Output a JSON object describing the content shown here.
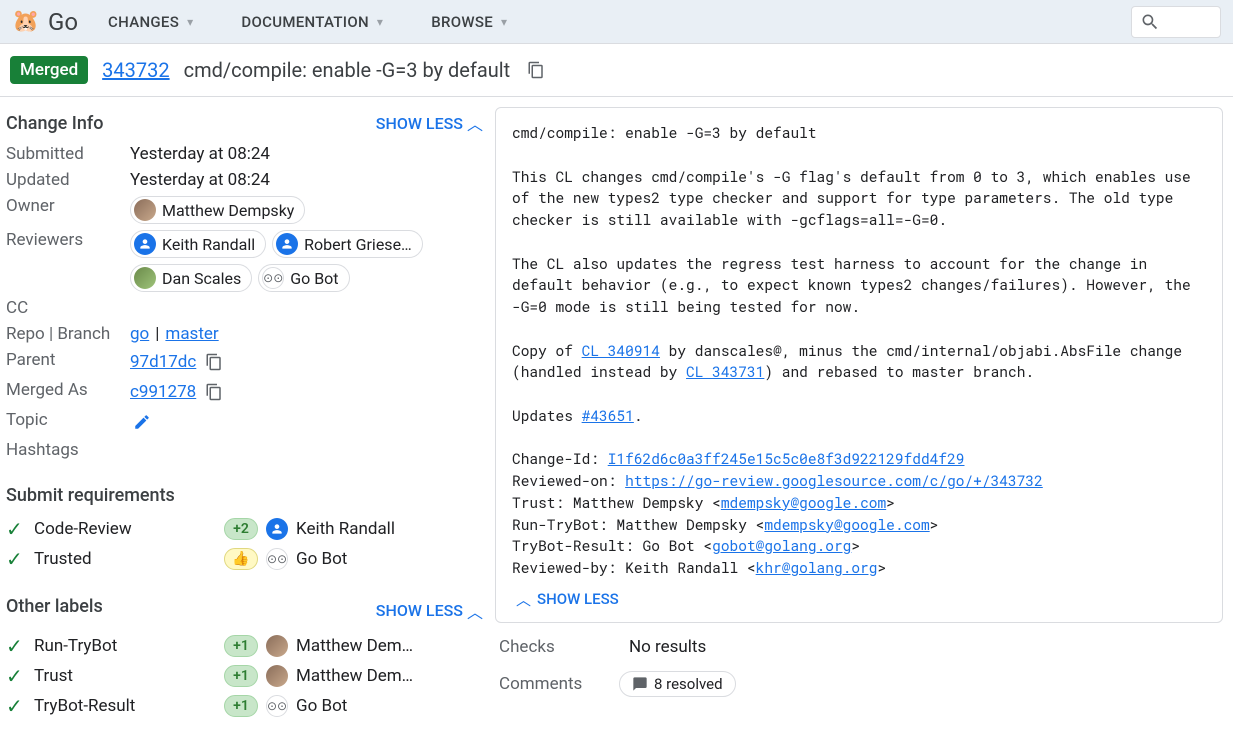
{
  "nav": {
    "brand": "Go",
    "items": [
      "CHANGES",
      "DOCUMENTATION",
      "BROWSE"
    ]
  },
  "header": {
    "status": "Merged",
    "cl_number": "343732",
    "subject": "cmd/compile: enable -G=3 by default"
  },
  "info": {
    "title": "Change Info",
    "showless": "SHOW LESS",
    "submitted_label": "Submitted",
    "submitted_value": "Yesterday at 08:24",
    "updated_label": "Updated",
    "updated_value": "Yesterday at 08:24",
    "owner_label": "Owner",
    "owner": "Matthew Dempsky",
    "reviewers_label": "Reviewers",
    "reviewers": [
      "Keith Randall",
      "Robert Griese…",
      "Dan Scales",
      "Go Bot"
    ],
    "cc_label": "CC",
    "repo_label": "Repo | Branch",
    "repo": "go",
    "branch": "master",
    "parent_label": "Parent",
    "parent": "97d17dc",
    "merged_label": "Merged As",
    "merged_as": "c991278",
    "topic_label": "Topic",
    "hashtags_label": "Hashtags"
  },
  "submit_req": {
    "title": "Submit requirements",
    "items": [
      {
        "name": "Code-Review",
        "vote": "+2",
        "vote_type": "green",
        "user": "Keith Randall",
        "avatar": "generic"
      },
      {
        "name": "Trusted",
        "vote": "👍",
        "vote_type": "thumb",
        "user": "Go Bot",
        "avatar": "bot"
      }
    ]
  },
  "other_labels": {
    "title": "Other labels",
    "showless": "SHOW LESS",
    "items": [
      {
        "name": "Run-TryBot",
        "vote": "+1",
        "user": "Matthew Dem…",
        "avatar": "photo1"
      },
      {
        "name": "Trust",
        "vote": "+1",
        "user": "Matthew Dem…",
        "avatar": "photo1"
      },
      {
        "name": "TryBot-Result",
        "vote": "+1",
        "user": "Go Bot",
        "avatar": "bot"
      }
    ]
  },
  "message": {
    "line1": "cmd/compile: enable -G=3 by default",
    "para1": "This CL changes cmd/compile's -G flag's default from 0 to 3, which enables use of the new types2 type checker and support for type parameters. The old type checker is still available with -gcflags=all=-G=0.",
    "para2": "The CL also updates the regress test harness to account for the change in default behavior (e.g., to expect known types2 changes/failures). However, the -G=0 mode is still being tested for now.",
    "copy_pre": "Copy of ",
    "copy_link": "CL 340914",
    "copy_post": " by danscales@, minus the cmd/internal/objabi.AbsFile change (handled instead by ",
    "copy_link2": "CL 343731",
    "copy_post2": ") and rebased to master branch.",
    "updates_pre": "Updates ",
    "updates_link": "#43651",
    "updates_post": ".",
    "changeid_pre": "Change-Id: ",
    "changeid": "I1f62d6c0a3ff245e15c5c0e8f3d922129fdd4f29",
    "reviewed_pre": "Reviewed-on: ",
    "reviewed_url": "https://go-review.googlesource.com/c/go/+/343732",
    "trust_line_pre": "Trust: Matthew Dempsky <",
    "trust_email": "mdempsky@google.com",
    "runtry_pre": "Run-TryBot: Matthew Dempsky <",
    "runtry_email": "mdempsky@google.com",
    "trybot_pre": "TryBot-Result: Go Bot <",
    "trybot_email": "gobot@golang.org",
    "revby_pre": "Reviewed-by: Keith Randall <",
    "revby_email": "khr@golang.org",
    "showless": "SHOW LESS"
  },
  "footer": {
    "checks_label": "Checks",
    "checks_value": "No results",
    "comments_label": "Comments",
    "comments_value": "8 resolved"
  }
}
